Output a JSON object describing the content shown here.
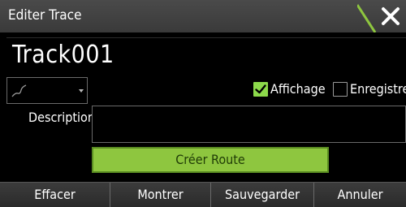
{
  "window": {
    "title": "Editer Trace"
  },
  "track": {
    "name": "Track001"
  },
  "options": {
    "display_label": "Affichage",
    "display_checked": true,
    "record_label": "Enregistrer",
    "record_checked": false
  },
  "description": {
    "label": "Description",
    "value": ""
  },
  "actions": {
    "create_route_label": "Créer Route"
  },
  "bottom": {
    "delete_label": "Effacer",
    "show_label": "Montrer",
    "save_label": "Sauvegarder",
    "cancel_label": "Annuler"
  },
  "colors": {
    "accent_green": "#8ec63f",
    "titlebar": "#444444",
    "background": "#000000"
  },
  "icons": {
    "close": "close-icon",
    "line_style": "line-style-icon",
    "checkmark": "checkmark-icon"
  }
}
